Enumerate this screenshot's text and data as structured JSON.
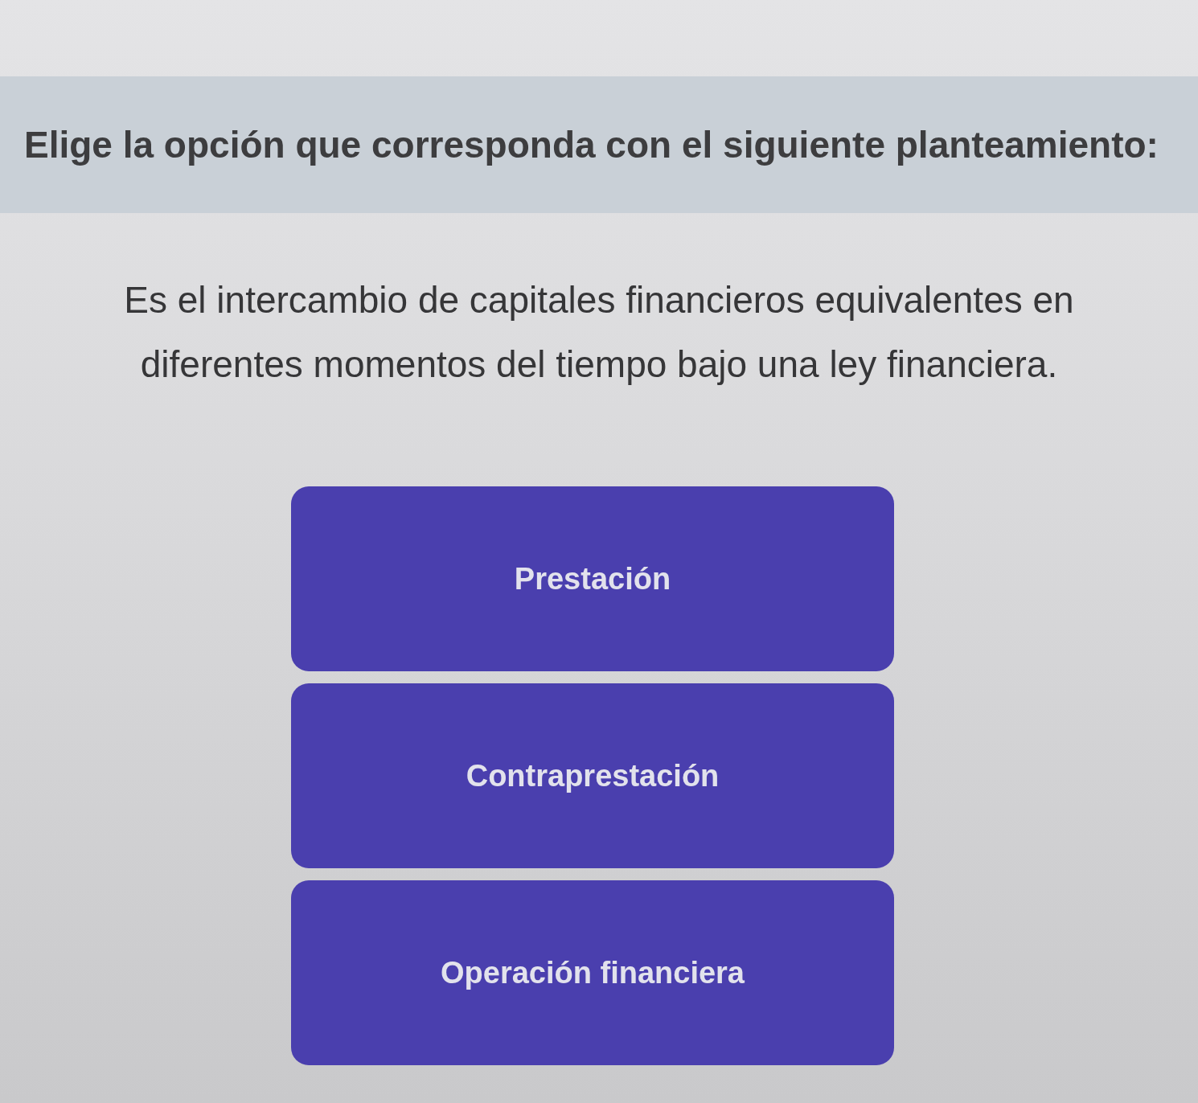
{
  "instruction": "Elige la opción que corresponda con el siguiente planteamiento:",
  "question": "Es el intercambio de capitales financieros equivalentes en diferentes momentos del tiempo bajo una ley financiera.",
  "options": [
    {
      "label": "Prestación"
    },
    {
      "label": "Contraprestación"
    },
    {
      "label": "Operación financiera"
    }
  ]
}
